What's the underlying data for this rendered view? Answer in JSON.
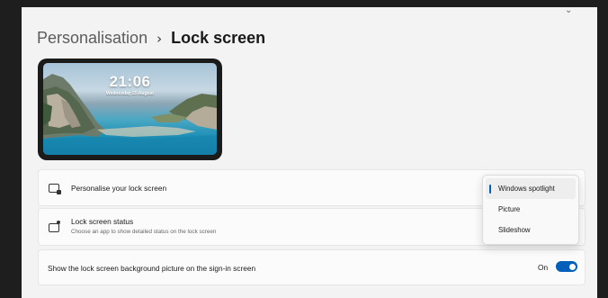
{
  "window": {
    "top_icon": "help-icon"
  },
  "breadcrumb": {
    "parent": "Personalisation",
    "separator": "›",
    "current": "Lock screen"
  },
  "preview": {
    "time": "21:06",
    "date": "Wednesday 25 August"
  },
  "rows": [
    {
      "title": "Personalise your lock screen",
      "icon": "lock-screen-icon"
    },
    {
      "title": "Lock screen status",
      "description": "Choose an app to show detailed status on the lock screen",
      "icon": "status-icon"
    },
    {
      "title": "Show the lock screen background picture on the sign-in screen"
    }
  ],
  "dropdown": {
    "options": [
      "Windows spotlight",
      "Picture",
      "Slideshow"
    ],
    "selected": "Windows spotlight",
    "accent": "#005fb8"
  },
  "toggle": {
    "label": "On",
    "state": true,
    "color": "#005fb8"
  }
}
